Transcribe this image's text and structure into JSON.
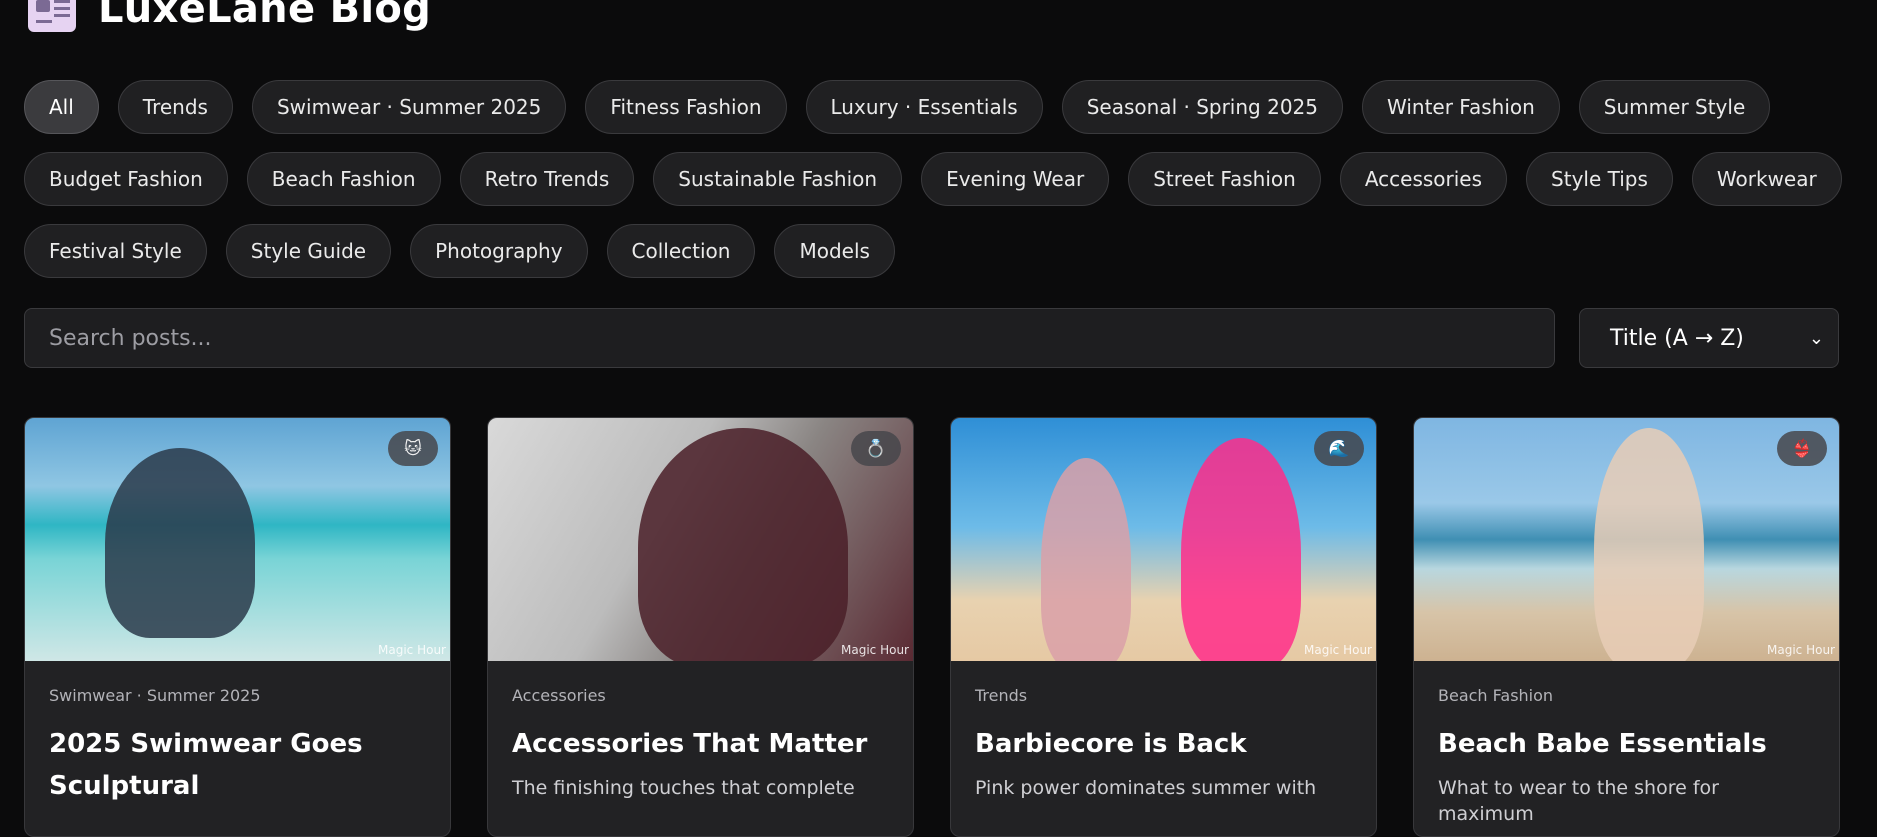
{
  "header": {
    "title": "LuxeLane Blog",
    "logo_icon": "newspaper-icon"
  },
  "filters": [
    [
      "All",
      "Trends",
      "Swimwear · Summer 2025",
      "Fitness Fashion",
      "Luxury · Essentials",
      "Seasonal · Spring 2025",
      "Winter Fashion",
      "Summer Style"
    ],
    [
      "Budget Fashion",
      "Beach Fashion",
      "Retro Trends",
      "Sustainable Fashion",
      "Evening Wear",
      "Street Fashion",
      "Accessories",
      "Style Tips",
      "Workwear"
    ],
    [
      "Festival Style",
      "Style Guide",
      "Photography",
      "Collection",
      "Models"
    ]
  ],
  "active_filter": "All",
  "search": {
    "placeholder": "Search posts..."
  },
  "sort": {
    "selected": "Title (A → Z)"
  },
  "posts": [
    {
      "category": "Swimwear · Summer 2025",
      "title": "2025 Swimwear Goes Sculptural",
      "excerpt": "",
      "badge": "🐱",
      "watermark": "Magic Hour"
    },
    {
      "category": "Accessories",
      "title": "Accessories That Matter",
      "excerpt": "The finishing touches that complete",
      "badge": "💍",
      "watermark": "Magic Hour"
    },
    {
      "category": "Trends",
      "title": "Barbiecore is Back",
      "excerpt": "Pink power dominates summer with",
      "badge": "🌊",
      "watermark": "Magic Hour"
    },
    {
      "category": "Beach Fashion",
      "title": "Beach Babe Essentials",
      "excerpt": "What to wear to the shore for maximum",
      "badge": "👙",
      "watermark": "Magic Hour"
    }
  ]
}
